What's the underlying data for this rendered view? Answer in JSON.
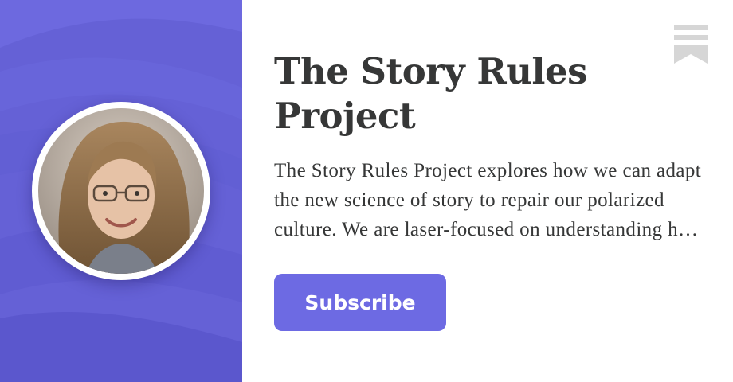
{
  "publication": {
    "title": "The Story Rules Project",
    "description": "The Story Rules Project explores how we can adapt the new science of story to repair our polarized culture. We are laser-focused on understanding how narrative shapes belief and action."
  },
  "actions": {
    "subscribe_label": "Subscribe"
  },
  "avatar": {
    "alt": "Author portrait"
  },
  "colors": {
    "brand_panel": "#6561d6",
    "button": "#6d6ae3",
    "text": "#363737",
    "bookmark": "#d6d6d6"
  }
}
